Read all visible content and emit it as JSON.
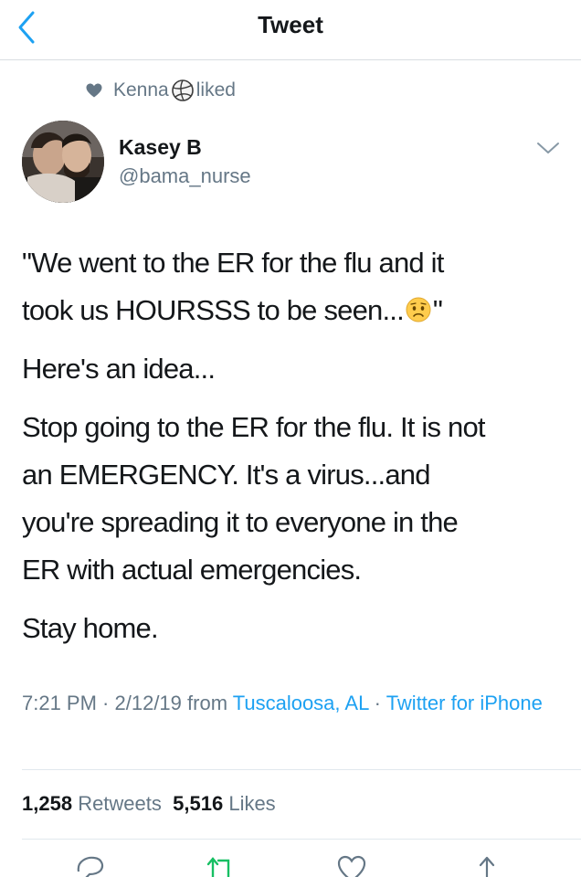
{
  "nav": {
    "title": "Tweet"
  },
  "context": {
    "liker_name": "Kenna",
    "action": "liked"
  },
  "author": {
    "name": "Kasey B",
    "handle": "@bama_nurse"
  },
  "tweet": {
    "p1_line1": "\"We went to the ER for the flu and it",
    "p1_line2": "took us HOURSSS to be seen...",
    "p1_close": "\"",
    "p2": "Here's an idea...",
    "p3_line1": "Stop going to the ER for the flu. It is not",
    "p3_line2": "an EMERGENCY. It's a virus...and",
    "p3_line3": "you're spreading it to everyone in the",
    "p3_line4": "ER with actual emergencies.",
    "p4": "Stay home."
  },
  "meta": {
    "time": "7:21 PM",
    "sep1": " · ",
    "date": "2/12/19 from ",
    "location": "Tuscaloosa, AL",
    "sep2": " · ",
    "source": "Twitter for iPhone"
  },
  "stats": {
    "retweets_count": "1,258",
    "retweets_label": "Retweets",
    "likes_count": "5,516",
    "likes_label": "Likes"
  },
  "colors": {
    "accent": "#1da1f2",
    "secondary_text": "#657786",
    "primary_text": "#14171a"
  },
  "icons": [
    "back-chevron-icon",
    "heart-icon",
    "chevron-down-icon",
    "reply-icon",
    "retweet-icon",
    "like-icon",
    "share-icon"
  ]
}
